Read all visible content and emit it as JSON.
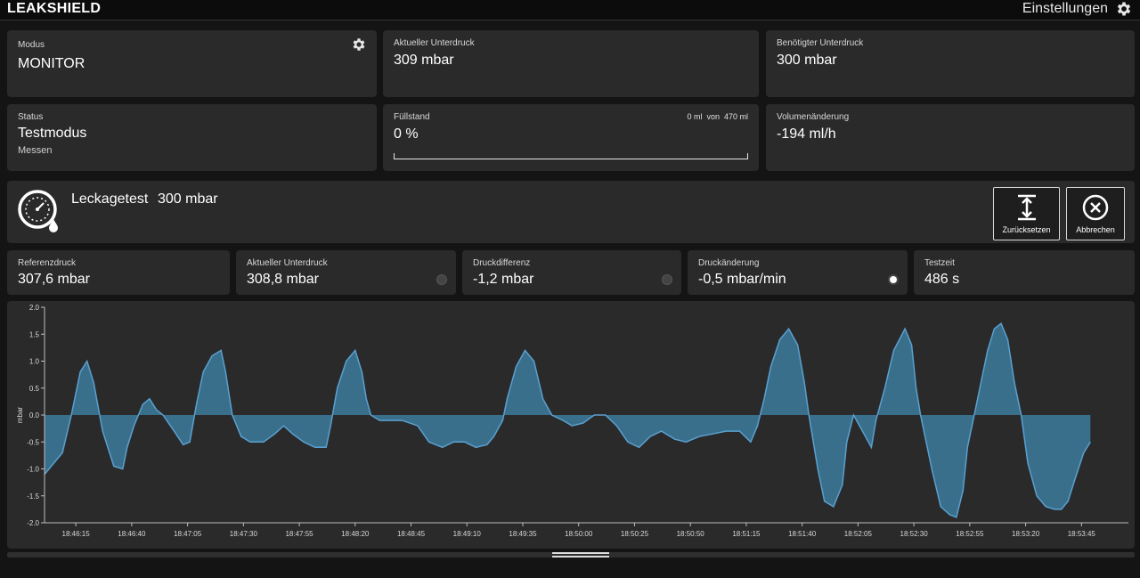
{
  "header": {
    "brand": "LEAKSHIELD",
    "settings_label": "Einstellungen"
  },
  "cards": {
    "modus": {
      "label": "Modus",
      "value": "MONITOR"
    },
    "aktueller_unterdruck": {
      "label": "Aktueller Unterdruck",
      "value": "309 mbar"
    },
    "benoetigter_unterdruck": {
      "label": "Benötigter Unterdruck",
      "value": "300 mbar"
    },
    "status": {
      "label": "Status",
      "value": "Testmodus",
      "sub": "Messen"
    },
    "fuellstand": {
      "label": "Füllstand",
      "value": "0 %",
      "current": "0 ml",
      "of": "von",
      "max": "470 ml",
      "fill_fraction": 0
    },
    "volumenaenderung": {
      "label": "Volumenänderung",
      "value": "-194 ml/h"
    }
  },
  "leaktest": {
    "title": "Leckagetest",
    "value": "300 mbar",
    "reset_label": "Zurücksetzen",
    "cancel_label": "Abbrechen"
  },
  "metrics": {
    "referenzdruck": {
      "label": "Referenzdruck",
      "value": "307,6 mbar"
    },
    "aktueller_unterdruck": {
      "label": "Aktueller Unterdruck",
      "value": "308,8 mbar",
      "indicator_on": false
    },
    "druckdifferenz": {
      "label": "Druckdifferenz",
      "value": "-1,2 mbar",
      "indicator_on": false
    },
    "druckaenderung": {
      "label": "Druckänderung",
      "value": "-0,5 mbar/min",
      "indicator_on": true
    },
    "testzeit": {
      "label": "Testzeit",
      "value": "486 s"
    }
  },
  "colors": {
    "accent": "#5aa0d0",
    "area_fill": "#3a6f8c",
    "panel": "#2a2a2a",
    "background": "#141414"
  },
  "chart_data": {
    "type": "area",
    "ylabel": "mbar",
    "ylim": [
      -2.0,
      2.0
    ],
    "y_ticks": [
      "2.0",
      "1.5",
      "1.0",
      "0.5",
      "0.0",
      "-0.5",
      "-1.0",
      "-1.5",
      "-2.0"
    ],
    "x_tick_labels": [
      "18:46:15",
      "18:46:40",
      "18:47:05",
      "18:47:30",
      "18:47:55",
      "18:48:20",
      "18:48:45",
      "18:49:10",
      "18:49:35",
      "18:50:00",
      "18:50:25",
      "18:50:50",
      "18:51:15",
      "18:51:40",
      "18:52:05",
      "18:52:30",
      "18:52:55",
      "18:53:20",
      "18:53:45"
    ],
    "x_range_seconds": [
      0,
      485
    ],
    "first_tick_offset_seconds": 14,
    "tick_interval_seconds": 25,
    "grid": false,
    "points": [
      [
        0,
        -1.1
      ],
      [
        8,
        -0.7
      ],
      [
        12,
        0.0
      ],
      [
        16,
        0.8
      ],
      [
        19,
        1.0
      ],
      [
        22,
        0.6
      ],
      [
        26,
        -0.3
      ],
      [
        31,
        -0.95
      ],
      [
        35,
        -1.0
      ],
      [
        37,
        -0.6
      ],
      [
        40,
        -0.2
      ],
      [
        44,
        0.2
      ],
      [
        47,
        0.3
      ],
      [
        50,
        0.1
      ],
      [
        53,
        0.0
      ],
      [
        58,
        -0.3
      ],
      [
        62,
        -0.55
      ],
      [
        65,
        -0.5
      ],
      [
        68,
        0.2
      ],
      [
        71,
        0.8
      ],
      [
        75,
        1.1
      ],
      [
        79,
        1.2
      ],
      [
        81,
        0.8
      ],
      [
        84,
        0.0
      ],
      [
        88,
        -0.4
      ],
      [
        92,
        -0.5
      ],
      [
        98,
        -0.5
      ],
      [
        103,
        -0.35
      ],
      [
        107,
        -0.2
      ],
      [
        111,
        -0.35
      ],
      [
        116,
        -0.5
      ],
      [
        121,
        -0.6
      ],
      [
        126,
        -0.6
      ],
      [
        128,
        -0.2
      ],
      [
        131,
        0.5
      ],
      [
        135,
        1.0
      ],
      [
        139,
        1.2
      ],
      [
        142,
        0.8
      ],
      [
        144,
        0.3
      ],
      [
        146,
        0.0
      ],
      [
        150,
        -0.1
      ],
      [
        160,
        -0.1
      ],
      [
        167,
        -0.2
      ],
      [
        172,
        -0.5
      ],
      [
        178,
        -0.6
      ],
      [
        183,
        -0.5
      ],
      [
        188,
        -0.5
      ],
      [
        193,
        -0.6
      ],
      [
        198,
        -0.55
      ],
      [
        201,
        -0.4
      ],
      [
        205,
        -0.1
      ],
      [
        207,
        0.3
      ],
      [
        211,
        0.9
      ],
      [
        215,
        1.2
      ],
      [
        219,
        1.0
      ],
      [
        223,
        0.3
      ],
      [
        227,
        0.0
      ],
      [
        232,
        -0.1
      ],
      [
        236,
        -0.2
      ],
      [
        241,
        -0.15
      ],
      [
        246,
        0.0
      ],
      [
        251,
        0.0
      ],
      [
        256,
        -0.2
      ],
      [
        261,
        -0.5
      ],
      [
        266,
        -0.6
      ],
      [
        271,
        -0.4
      ],
      [
        276,
        -0.3
      ],
      [
        282,
        -0.45
      ],
      [
        287,
        -0.5
      ],
      [
        293,
        -0.4
      ],
      [
        299,
        -0.35
      ],
      [
        305,
        -0.3
      ],
      [
        311,
        -0.3
      ],
      [
        316,
        -0.5
      ],
      [
        319,
        -0.2
      ],
      [
        322,
        0.3
      ],
      [
        325,
        0.9
      ],
      [
        329,
        1.4
      ],
      [
        333,
        1.6
      ],
      [
        337,
        1.3
      ],
      [
        340,
        0.6
      ],
      [
        342,
        0.0
      ],
      [
        346,
        -1.0
      ],
      [
        349,
        -1.6
      ],
      [
        353,
        -1.7
      ],
      [
        357,
        -1.3
      ],
      [
        359,
        -0.5
      ],
      [
        362,
        0.0
      ],
      [
        366,
        -0.3
      ],
      [
        370,
        -0.6
      ],
      [
        372,
        -0.1
      ],
      [
        376,
        0.5
      ],
      [
        380,
        1.2
      ],
      [
        385,
        1.6
      ],
      [
        388,
        1.3
      ],
      [
        390,
        0.5
      ],
      [
        392,
        0.0
      ],
      [
        397,
        -1.0
      ],
      [
        401,
        -1.7
      ],
      [
        405,
        -1.85
      ],
      [
        408,
        -1.9
      ],
      [
        411,
        -1.4
      ],
      [
        413,
        -0.6
      ],
      [
        416,
        0.0
      ],
      [
        419,
        0.6
      ],
      [
        422,
        1.2
      ],
      [
        425,
        1.6
      ],
      [
        428,
        1.7
      ],
      [
        431,
        1.4
      ],
      [
        434,
        0.6
      ],
      [
        437,
        0.0
      ],
      [
        440,
        -0.9
      ],
      [
        444,
        -1.5
      ],
      [
        448,
        -1.7
      ],
      [
        452,
        -1.75
      ],
      [
        455,
        -1.75
      ],
      [
        458,
        -1.6
      ],
      [
        461,
        -1.2
      ],
      [
        465,
        -0.7
      ],
      [
        468,
        -0.5
      ]
    ]
  }
}
